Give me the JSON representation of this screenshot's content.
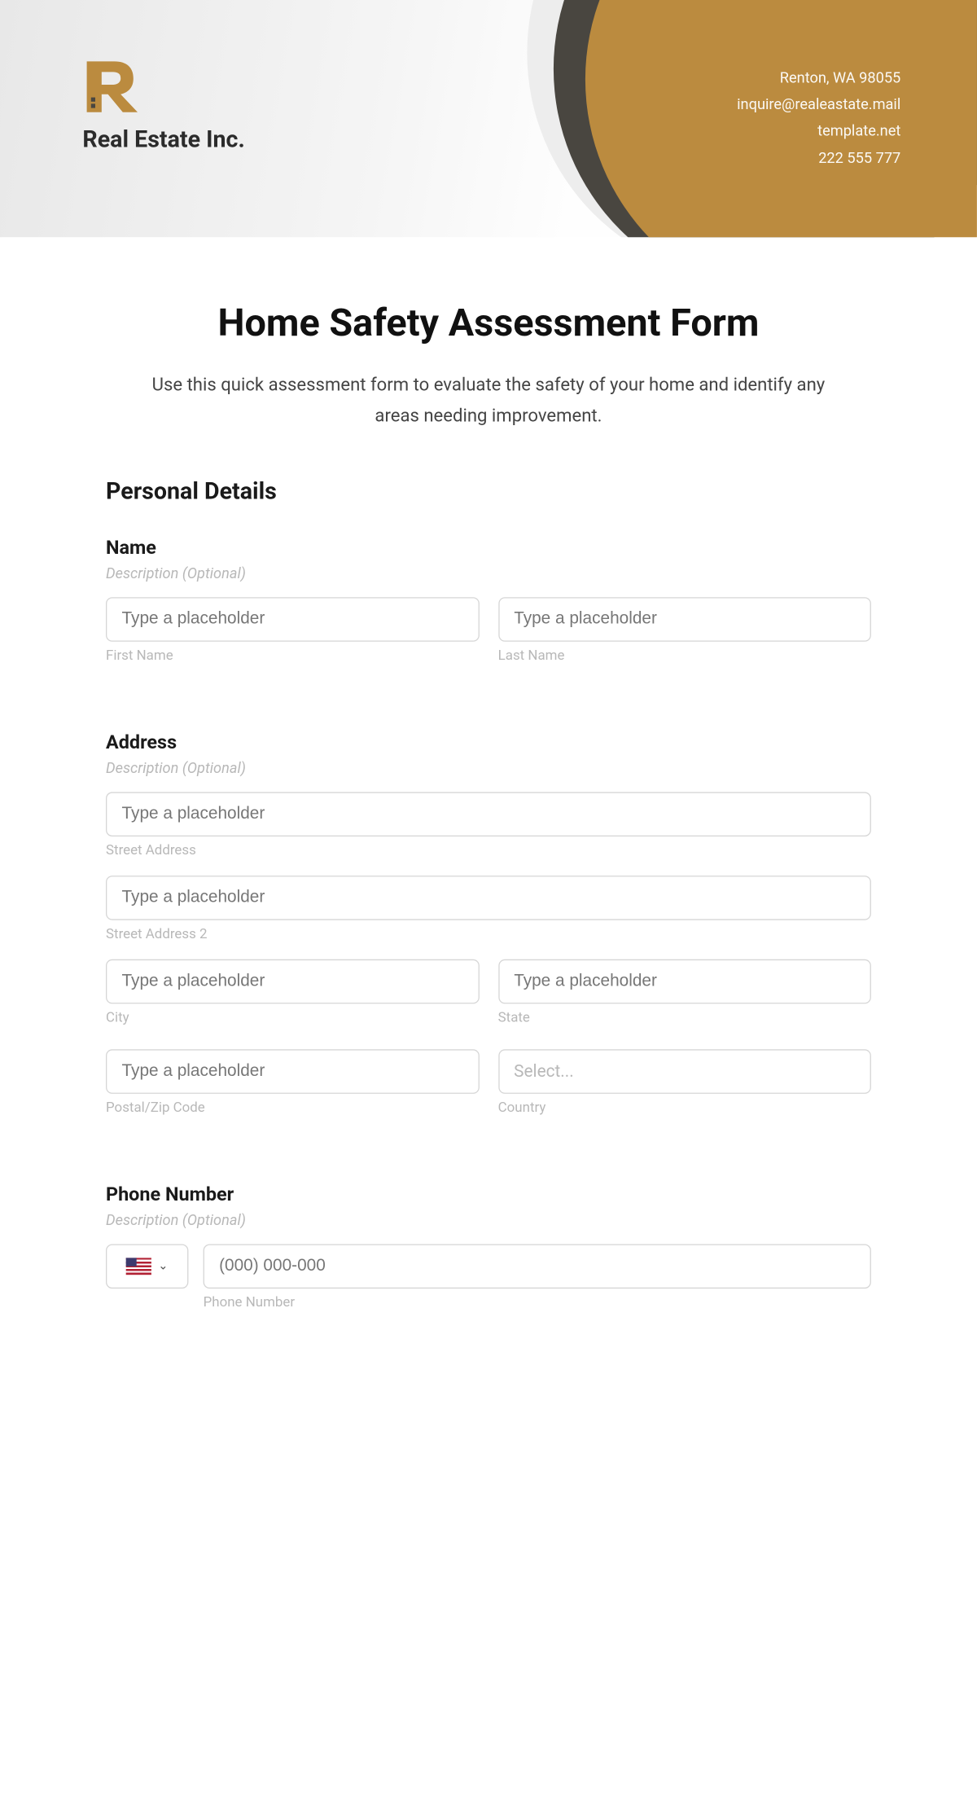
{
  "header": {
    "company_name": "Real Estate Inc.",
    "contact": {
      "location": "Renton, WA 98055",
      "email": "inquire@realeastate.mail",
      "website": "template.net",
      "phone": "222 555 777"
    }
  },
  "form": {
    "title": "Home Safety Assessment Form",
    "description": "Use this quick assessment form to evaluate the safety of your home and identify any areas needing improvement."
  },
  "sections": {
    "personal_title": "Personal Details"
  },
  "fields": {
    "name": {
      "label": "Name",
      "desc": "Description (Optional)",
      "first_placeholder": "Type a placeholder",
      "last_placeholder": "Type a placeholder",
      "first_sub": "First Name",
      "last_sub": "Last Name"
    },
    "address": {
      "label": "Address",
      "desc": "Description (Optional)",
      "street1_placeholder": "Type a placeholder",
      "street1_sub": "Street Address",
      "street2_placeholder": "Type a placeholder",
      "street2_sub": "Street Address 2",
      "city_placeholder": "Type a placeholder",
      "city_sub": "City",
      "state_placeholder": "Type a placeholder",
      "state_sub": "State",
      "postal_placeholder": "Type a placeholder",
      "postal_sub": "Postal/Zip Code",
      "country_placeholder": "Select...",
      "country_sub": "Country"
    },
    "phone": {
      "label": "Phone Number",
      "desc": "Description (Optional)",
      "placeholder": "(000) 000-000",
      "sub": "Phone Number"
    }
  }
}
